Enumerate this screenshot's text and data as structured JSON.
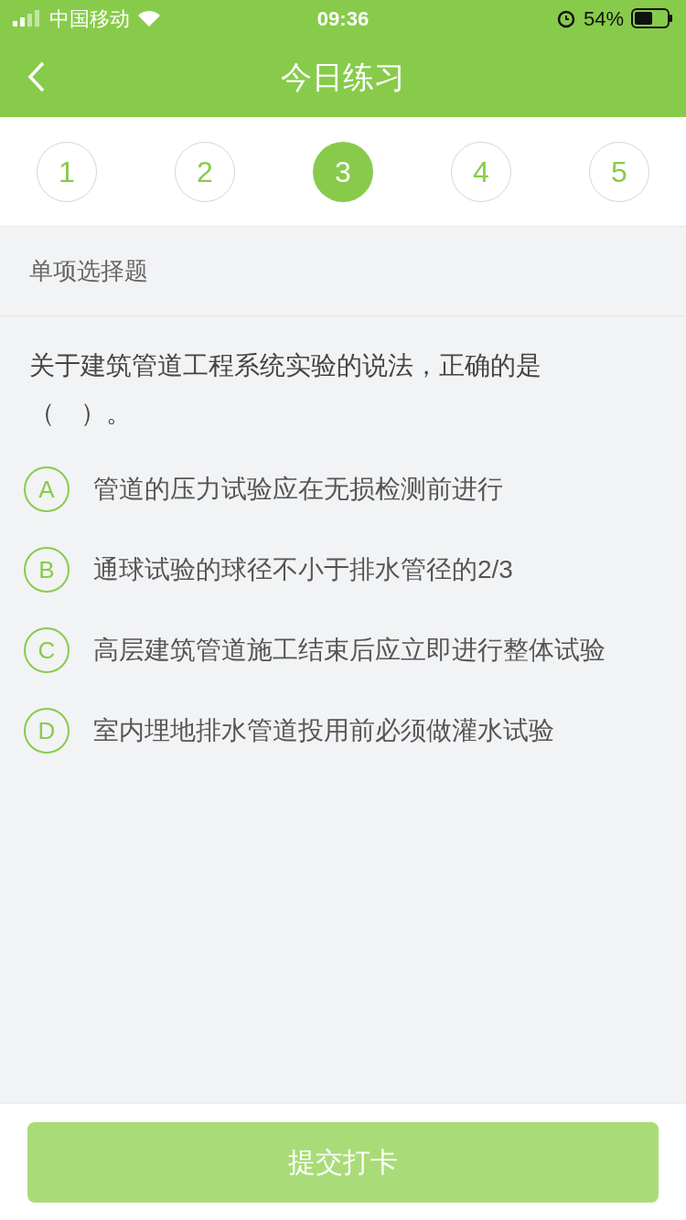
{
  "status_bar": {
    "carrier": "中国移动",
    "time": "09:36",
    "battery": "54%"
  },
  "nav": {
    "title": "今日练习"
  },
  "steps": [
    {
      "label": "1",
      "selected": false
    },
    {
      "label": "2",
      "selected": false
    },
    {
      "label": "3",
      "selected": true
    },
    {
      "label": "4",
      "selected": false
    },
    {
      "label": "5",
      "selected": false
    }
  ],
  "section": {
    "title": "单项选择题"
  },
  "question": {
    "text": "关于建筑管道工程系统实验的说法，正确的是（　）。"
  },
  "options": [
    {
      "letter": "A",
      "text": "管道的压力试验应在无损检测前进行",
      "selected": false
    },
    {
      "letter": "B",
      "text": "通球试验的球径不小于排水管径的2/3",
      "selected": false
    },
    {
      "letter": "C",
      "text": "高层建筑管道施工结束后应立即进行整体试验",
      "selected": false
    },
    {
      "letter": "D",
      "text": "室内埋地排水管道投用前必须做灌水试验",
      "selected": false
    }
  ],
  "submit": {
    "label": "提交打卡",
    "disabled": true
  }
}
